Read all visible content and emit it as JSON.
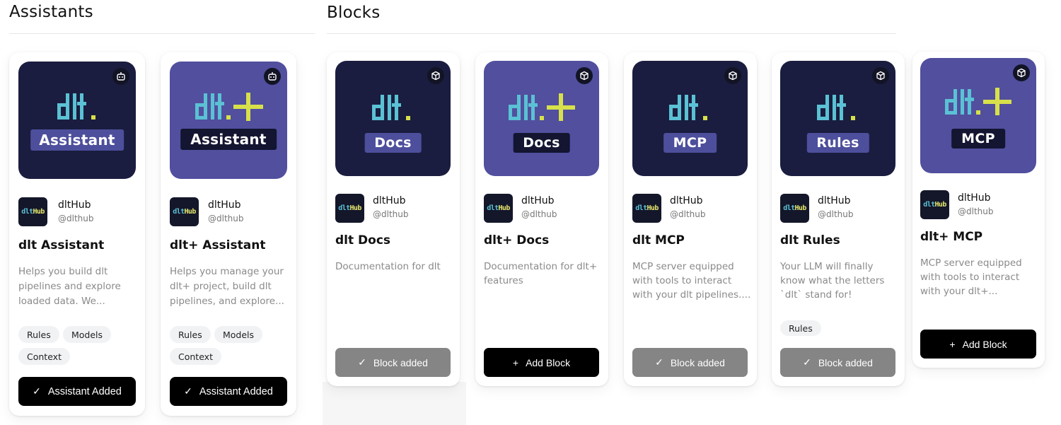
{
  "sections": {
    "assistants_title": "Assistants",
    "blocks_title": "Blocks"
  },
  "icons": {
    "assistant_type": "robot-icon",
    "block_type": "cube-icon",
    "check": "check-icon",
    "plus": "plus-icon"
  },
  "colors": {
    "cover_dark": "#1a1d3f",
    "cover_purple": "#514f9e",
    "logo_cyan": "#5bc1d4",
    "logo_yellow": "#d7e04a",
    "added_button": "#858585",
    "primary_button": "#000000"
  },
  "assistants": [
    {
      "logo": "dlt",
      "badge": "Assistant",
      "author": "dltHub",
      "handle": "@dlthub",
      "author_logo": {
        "dl": "dlt",
        "hub": "Hub"
      },
      "title": "dlt Assistant",
      "desc": [
        "Helps you build dlt",
        "pipelines and explore",
        "loaded data. We..."
      ],
      "tags": [
        "Rules",
        "Models",
        "Context"
      ],
      "button": "Assistant Added"
    },
    {
      "logo": "dlt+",
      "badge": "Assistant",
      "author": "dltHub",
      "handle": "@dlthub",
      "author_logo": {
        "dl": "dlt",
        "hub": "Hub"
      },
      "title": "dlt+ Assistant",
      "desc": [
        "Helps you manage your",
        "dlt+ project, build dlt",
        "pipelines, and explore..."
      ],
      "tags": [
        "Rules",
        "Models",
        "Context"
      ],
      "button": "Assistant Added"
    }
  ],
  "blocks": [
    {
      "logo": "dlt",
      "badge": "Docs",
      "author": "dltHub",
      "handle": "@dlthub",
      "author_logo": {
        "dl": "dlt",
        "hub": "Hub"
      },
      "title": "dlt Docs",
      "desc": [
        "Documentation for dlt"
      ],
      "tags": [],
      "button": "Block added"
    },
    {
      "logo": "dlt+",
      "badge": "Docs",
      "author": "dltHub",
      "handle": "@dlthub",
      "author_logo": {
        "dl": "dlt",
        "hub": "Hub"
      },
      "title": "dlt+ Docs",
      "desc": [
        "Documentation for dlt+",
        "features"
      ],
      "tags": [],
      "button": "Add Block"
    },
    {
      "logo": "dlt",
      "badge": "MCP",
      "author": "dltHub",
      "handle": "@dlthub",
      "author_logo": {
        "dl": "dlt",
        "hub": "Hub"
      },
      "title": "dlt MCP",
      "desc": [
        "MCP server equipped",
        "with tools to interact",
        "with your dlt pipelines...."
      ],
      "tags": [],
      "button": "Block added"
    },
    {
      "logo": "dlt",
      "badge": "Rules",
      "author": "dltHub",
      "handle": "@dlthub",
      "author_logo": {
        "dl": "dlt",
        "hub": "Hub"
      },
      "title": "dlt Rules",
      "desc": [
        "Your LLM will finally",
        "know what the letters",
        "`dlt` stand for!"
      ],
      "tags": [
        "Rules"
      ],
      "button": "Block added"
    },
    {
      "logo": "dlt+",
      "badge": "MCP",
      "author": "dltHub",
      "handle": "@dlthub",
      "author_logo": {
        "dl": "dlt",
        "hub": "Hub"
      },
      "title": "dlt+ MCP",
      "desc": [
        "MCP server equipped",
        "with tools to interact",
        "with your dlt+..."
      ],
      "tags": [],
      "button": "Add Block"
    }
  ]
}
